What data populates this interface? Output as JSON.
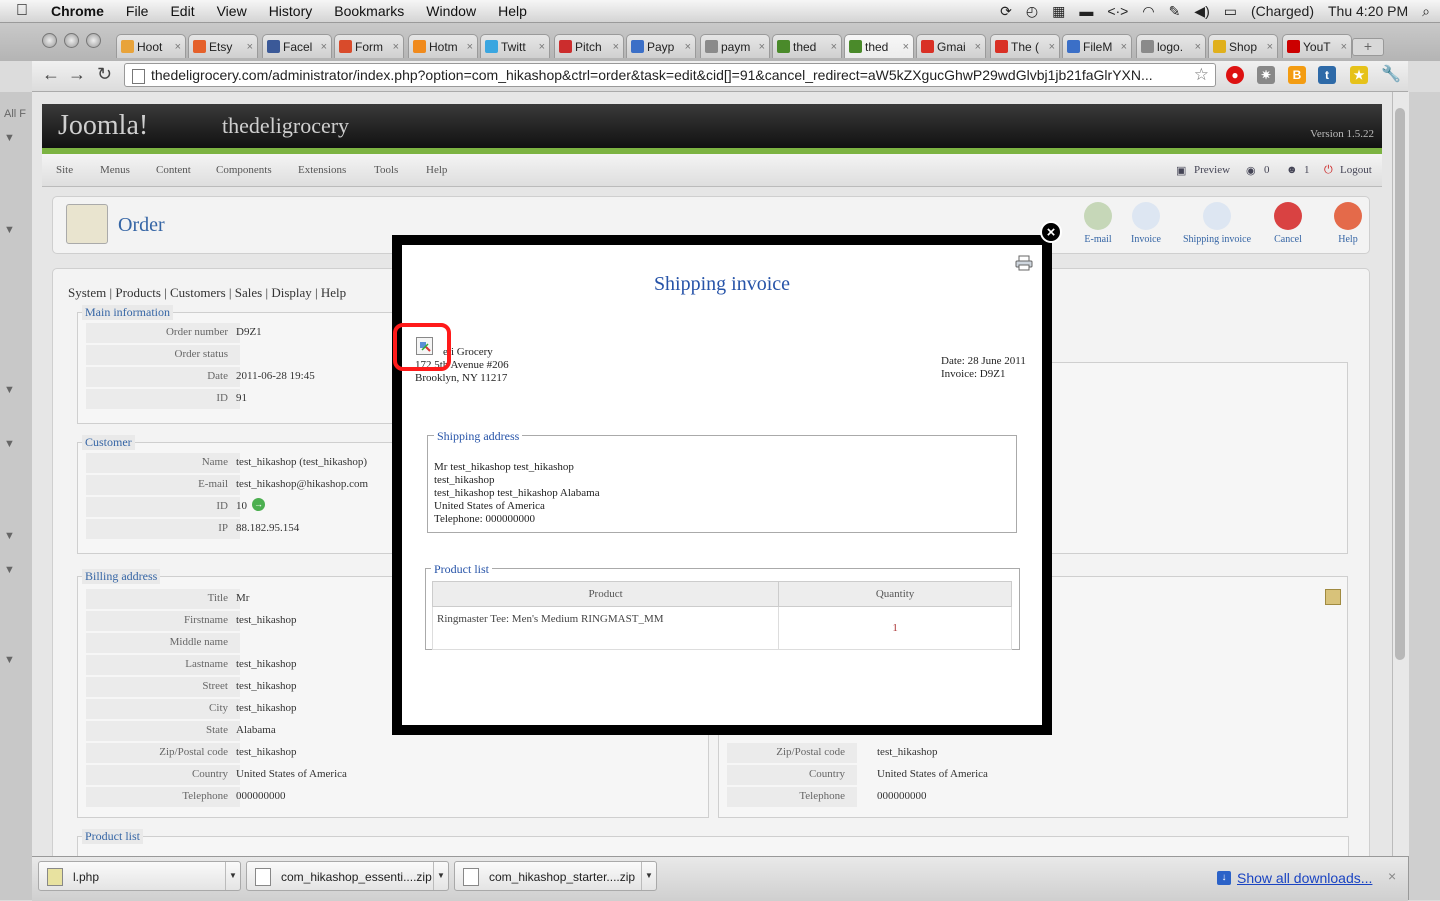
{
  "menubar": {
    "apple": "",
    "app": "Chrome",
    "items": [
      "File",
      "Edit",
      "View",
      "History",
      "Bookmarks",
      "Window",
      "Help"
    ],
    "battery": "(Charged)",
    "clock": "Thu 4:20 PM"
  },
  "tabs": [
    {
      "label": "Hoot",
      "color": "#e8a33a"
    },
    {
      "label": "Etsy",
      "color": "#e5602a"
    },
    {
      "label": "Facel",
      "color": "#3b5998"
    },
    {
      "label": "Form",
      "color": "#d94b2b"
    },
    {
      "label": "Hotm",
      "color": "#f08a1c"
    },
    {
      "label": "Twitt",
      "color": "#3aa6e0"
    },
    {
      "label": "Pitch",
      "color": "#cc2d2d"
    },
    {
      "label": "Payp",
      "color": "#3b6fc7"
    },
    {
      "label": "paym",
      "color": "#8a8a8a"
    },
    {
      "label": "thed",
      "color": "#4a8a2a"
    },
    {
      "label": "thed",
      "color": "#4a8a2a"
    },
    {
      "label": "Gmai",
      "color": "#d93025"
    },
    {
      "label": "The (",
      "color": "#d93025"
    },
    {
      "label": "FileM",
      "color": "#3b6fc7"
    },
    {
      "label": "logo.",
      "color": "#8a8a8a"
    },
    {
      "label": "Shop",
      "color": "#e0b01c"
    },
    {
      "label": "YouT",
      "color": "#cc0000"
    }
  ],
  "tab_close": "×",
  "address": "thedeligrocery.com/administrator/index.php?option=com_hikashop&ctrl=order&task=edit&cid[]=91&cancel_redirect=aW5kZXgucGhwP29wdGlvbj1jb21faGlrYXN...",
  "nav": {
    "back": "←",
    "forward": "→",
    "reload": "↻",
    "star": "☆"
  },
  "joomla": {
    "logo": "Joomla!",
    "site": "thedeligrocery",
    "version": "Version 1.5.22",
    "menu": [
      "Site",
      "Menus",
      "Content",
      "Components",
      "Extensions",
      "Tools",
      "Help"
    ],
    "preview": "Preview",
    "count1": "0",
    "count2": "1",
    "logout": "Logout"
  },
  "order": {
    "title": "Order",
    "toolbar": [
      "E-mail",
      "Invoice",
      "Shipping invoice",
      "Cancel",
      "Help"
    ],
    "subtabs": [
      "System",
      "Products",
      "Customers",
      "Sales",
      "Display",
      "Help"
    ],
    "main_info": {
      "legend": "Main information",
      "rows": [
        {
          "k": "Order number",
          "v": "D9Z1"
        },
        {
          "k": "Order status",
          "v": ""
        },
        {
          "k": "Date",
          "v": "2011-06-28 19:45"
        },
        {
          "k": "ID",
          "v": "91"
        }
      ]
    },
    "customer": {
      "legend": "Customer",
      "rows": [
        {
          "k": "Name",
          "v": "test_hikashop (test_hikashop)"
        },
        {
          "k": "E-mail",
          "v": "test_hikashop@hikashop.com"
        },
        {
          "k": "ID",
          "v": "10"
        },
        {
          "k": "IP",
          "v": "88.182.95.154"
        }
      ]
    },
    "billing": {
      "legend": "Billing address",
      "rows": [
        {
          "k": "Title",
          "v": "Mr"
        },
        {
          "k": "Firstname",
          "v": "test_hikashop"
        },
        {
          "k": "Middle name",
          "v": ""
        },
        {
          "k": "Lastname",
          "v": "test_hikashop"
        },
        {
          "k": "Street",
          "v": "test_hikashop"
        },
        {
          "k": "City",
          "v": "test_hikashop"
        },
        {
          "k": "State",
          "v": "Alabama"
        },
        {
          "k": "Zip/Postal code",
          "v": "test_hikashop"
        },
        {
          "k": "Country",
          "v": "United States of America"
        },
        {
          "k": "Telephone",
          "v": "000000000"
        }
      ]
    },
    "shipping_rows": [
      {
        "k": "Zip/Postal code",
        "v": "test_hikashop"
      },
      {
        "k": "Country",
        "v": "United States of America"
      },
      {
        "k": "Telephone",
        "v": "000000000"
      }
    ],
    "product_list_legend": "Product list"
  },
  "modal": {
    "close": "×",
    "title": "Shipping invoice",
    "company_lines": [
      "eli Grocery",
      "172 5th Avenue #206",
      "Brooklyn, NY 11217"
    ],
    "date_line": "Date: 28 June 2011",
    "invoice_line": "Invoice: D9Z1",
    "shipping_legend": "Shipping address",
    "shipping_lines": [
      "Mr test_hikashop test_hikashop",
      "test_hikashop",
      "test_hikashop test_hikashop Alabama",
      "United States of America",
      "Telephone: 000000000"
    ],
    "product_legend": "Product list",
    "th_product": "Product",
    "th_quantity": "Quantity",
    "product_name": "Ringmaster Tee: Men's Medium RINGMAST_MM",
    "product_qty": "1"
  },
  "downloads": {
    "items": [
      "l.php",
      "com_hikashop_essenti....zip",
      "com_hikashop_starter....zip"
    ],
    "show_all": "Show all downloads...",
    "close": "×"
  }
}
